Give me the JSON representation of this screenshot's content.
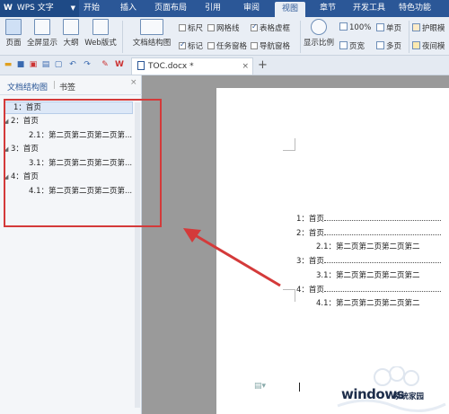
{
  "app": {
    "name": "WPS 文字",
    "logo": "W"
  },
  "tabs": [
    {
      "label": "开始"
    },
    {
      "label": "插入"
    },
    {
      "label": "页面布局"
    },
    {
      "label": "引用"
    },
    {
      "label": "审阅"
    },
    {
      "label": "视图"
    },
    {
      "label": "章节"
    },
    {
      "label": "开发工具"
    },
    {
      "label": "特色功能"
    }
  ],
  "ribbon": {
    "page_view": "页面",
    "fullscreen": "全屏显示",
    "outline": "大纲",
    "web_layout": "Web版式",
    "nav_pane": "文档结构图",
    "ruler": "标尺",
    "gridlines": "网格线",
    "table_gridlines": "表格虚框",
    "marks": "标记",
    "task_pane": "任务窗格",
    "nav_pane_small": "导航窗格",
    "zoom": "显示比例",
    "zoom_100": "100%",
    "single_page": "单页",
    "page_width": "页宽",
    "multi_page": "多页",
    "eye_protect": "护眼模",
    "night_mode": "夜间模"
  },
  "document": {
    "tab_title": "TOC.docx *"
  },
  "nav_panel": {
    "tab_structure": "文档结构图",
    "tab_bookmarks": "书签",
    "items": [
      {
        "text": "1：首页"
      },
      {
        "text": "2：首页"
      },
      {
        "text": "2.1：第二页第二页第二页第..."
      },
      {
        "text": "3：首页"
      },
      {
        "text": "3.1：第二页第二页第二页第..."
      },
      {
        "text": "4：首页"
      },
      {
        "text": "4.1：第二页第二页第二页第..."
      }
    ]
  },
  "toc": [
    {
      "text": "1：首页"
    },
    {
      "text": "2：首页"
    },
    {
      "text": "2.1：第二页第二页第二页第二"
    },
    {
      "text": "3：首页"
    },
    {
      "text": "3.1：第二页第二页第二页第二"
    },
    {
      "text": "4：首页"
    },
    {
      "text": "4.1：第二页第二页第二页第二"
    }
  ],
  "watermark": {
    "text": "windows",
    "subtext": "系统家园"
  },
  "colors": {
    "accent": "#2b5797",
    "annotation": "#d43a3a"
  }
}
